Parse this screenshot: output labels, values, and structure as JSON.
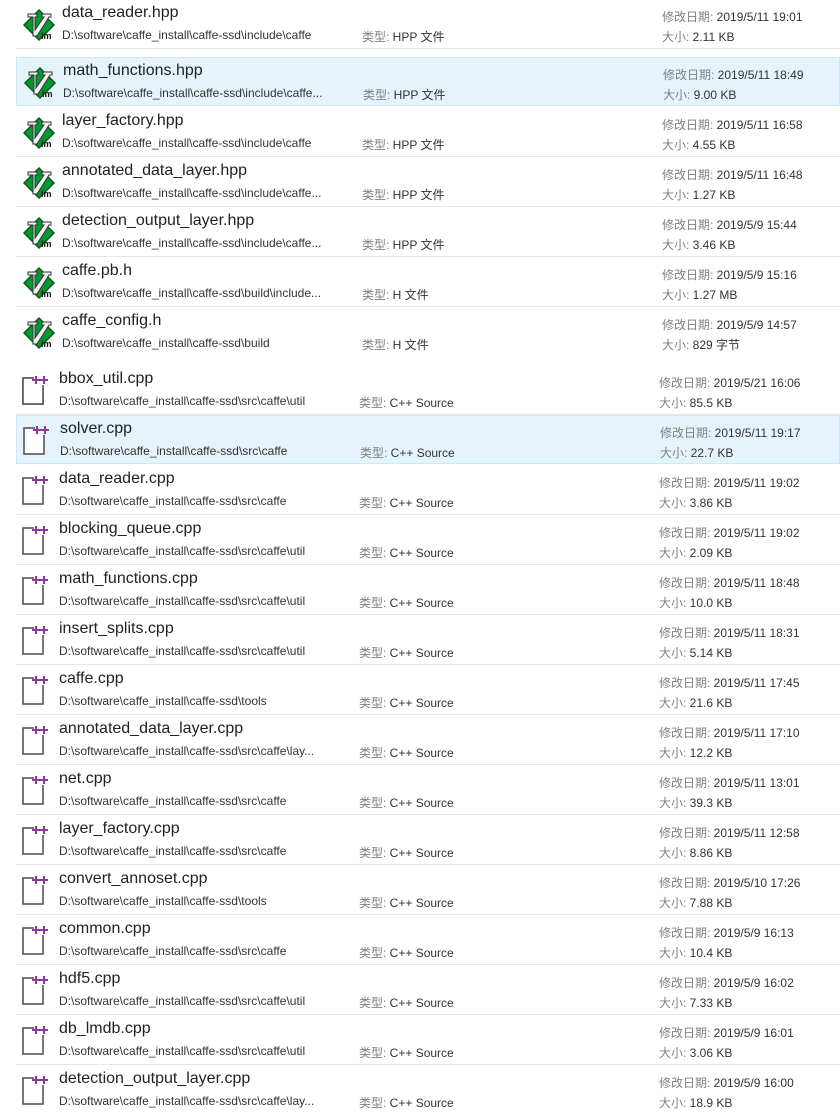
{
  "labels": {
    "date": "修改日期: ",
    "size": "大小: ",
    "type": "类型: "
  },
  "group1": [
    {
      "name": "data_reader.hpp",
      "path": "D:\\software\\caffe_install\\caffe-ssd\\include\\caffe",
      "type": "HPP 文件",
      "date": "2019/5/11 19:01",
      "size": "2.11 KB"
    },
    {
      "name": "math_functions.hpp",
      "path": "D:\\software\\caffe_install\\caffe-ssd\\include\\caffe...",
      "type": "HPP 文件",
      "date": "2019/5/11 18:49",
      "size": "9.00 KB"
    },
    {
      "name": "layer_factory.hpp",
      "path": "D:\\software\\caffe_install\\caffe-ssd\\include\\caffe",
      "type": "HPP 文件",
      "date": "2019/5/11 16:58",
      "size": "4.55 KB"
    },
    {
      "name": "annotated_data_layer.hpp",
      "path": "D:\\software\\caffe_install\\caffe-ssd\\include\\caffe...",
      "type": "HPP 文件",
      "date": "2019/5/11 16:48",
      "size": "1.27 KB"
    },
    {
      "name": "detection_output_layer.hpp",
      "path": "D:\\software\\caffe_install\\caffe-ssd\\include\\caffe...",
      "type": "HPP 文件",
      "date": "2019/5/9 15:44",
      "size": "3.46 KB"
    },
    {
      "name": "caffe.pb.h",
      "path": "D:\\software\\caffe_install\\caffe-ssd\\build\\include...",
      "type": "H 文件",
      "date": "2019/5/9 15:16",
      "size": "1.27 MB"
    },
    {
      "name": "caffe_config.h",
      "path": "D:\\software\\caffe_install\\caffe-ssd\\build",
      "type": "H 文件",
      "date": "2019/5/9 14:57",
      "size": "829 字节"
    }
  ],
  "group2": [
    {
      "name": "bbox_util.cpp",
      "path": "D:\\software\\caffe_install\\caffe-ssd\\src\\caffe\\util",
      "type": "C++ Source",
      "date": "2019/5/21 16:06",
      "size": "85.5 KB"
    },
    {
      "name": "solver.cpp",
      "path": "D:\\software\\caffe_install\\caffe-ssd\\src\\caffe",
      "type": "C++ Source",
      "date": "2019/5/11 19:17",
      "size": "22.7 KB"
    },
    {
      "name": "data_reader.cpp",
      "path": "D:\\software\\caffe_install\\caffe-ssd\\src\\caffe",
      "type": "C++ Source",
      "date": "2019/5/11 19:02",
      "size": "3.86 KB"
    },
    {
      "name": "blocking_queue.cpp",
      "path": "D:\\software\\caffe_install\\caffe-ssd\\src\\caffe\\util",
      "type": "C++ Source",
      "date": "2019/5/11 19:02",
      "size": "2.09 KB"
    },
    {
      "name": "math_functions.cpp",
      "path": "D:\\software\\caffe_install\\caffe-ssd\\src\\caffe\\util",
      "type": "C++ Source",
      "date": "2019/5/11 18:48",
      "size": "10.0 KB"
    },
    {
      "name": "insert_splits.cpp",
      "path": "D:\\software\\caffe_install\\caffe-ssd\\src\\caffe\\util",
      "type": "C++ Source",
      "date": "2019/5/11 18:31",
      "size": "5.14 KB"
    },
    {
      "name": "caffe.cpp",
      "path": "D:\\software\\caffe_install\\caffe-ssd\\tools",
      "type": "C++ Source",
      "date": "2019/5/11 17:45",
      "size": "21.6 KB"
    },
    {
      "name": "annotated_data_layer.cpp",
      "path": "D:\\software\\caffe_install\\caffe-ssd\\src\\caffe\\lay...",
      "type": "C++ Source",
      "date": "2019/5/11 17:10",
      "size": "12.2 KB"
    },
    {
      "name": "net.cpp",
      "path": "D:\\software\\caffe_install\\caffe-ssd\\src\\caffe",
      "type": "C++ Source",
      "date": "2019/5/11 13:01",
      "size": "39.3 KB"
    },
    {
      "name": "layer_factory.cpp",
      "path": "D:\\software\\caffe_install\\caffe-ssd\\src\\caffe",
      "type": "C++ Source",
      "date": "2019/5/11 12:58",
      "size": "8.86 KB"
    },
    {
      "name": "convert_annoset.cpp",
      "path": "D:\\software\\caffe_install\\caffe-ssd\\tools",
      "type": "C++ Source",
      "date": "2019/5/10 17:26",
      "size": "7.88 KB"
    },
    {
      "name": "common.cpp",
      "path": "D:\\software\\caffe_install\\caffe-ssd\\src\\caffe",
      "type": "C++ Source",
      "date": "2019/5/9 16:13",
      "size": "10.4 KB"
    },
    {
      "name": "hdf5.cpp",
      "path": "D:\\software\\caffe_install\\caffe-ssd\\src\\caffe\\util",
      "type": "C++ Source",
      "date": "2019/5/9 16:02",
      "size": "7.33 KB"
    },
    {
      "name": "db_lmdb.cpp",
      "path": "D:\\software\\caffe_install\\caffe-ssd\\src\\caffe\\util",
      "type": "C++ Source",
      "date": "2019/5/9 16:01",
      "size": "3.06 KB"
    },
    {
      "name": "detection_output_layer.cpp",
      "path": "D:\\software\\caffe_install\\caffe-ssd\\src\\caffe\\lay...",
      "type": "C++ Source",
      "date": "2019/5/9 16:00",
      "size": "18.9 KB"
    }
  ]
}
